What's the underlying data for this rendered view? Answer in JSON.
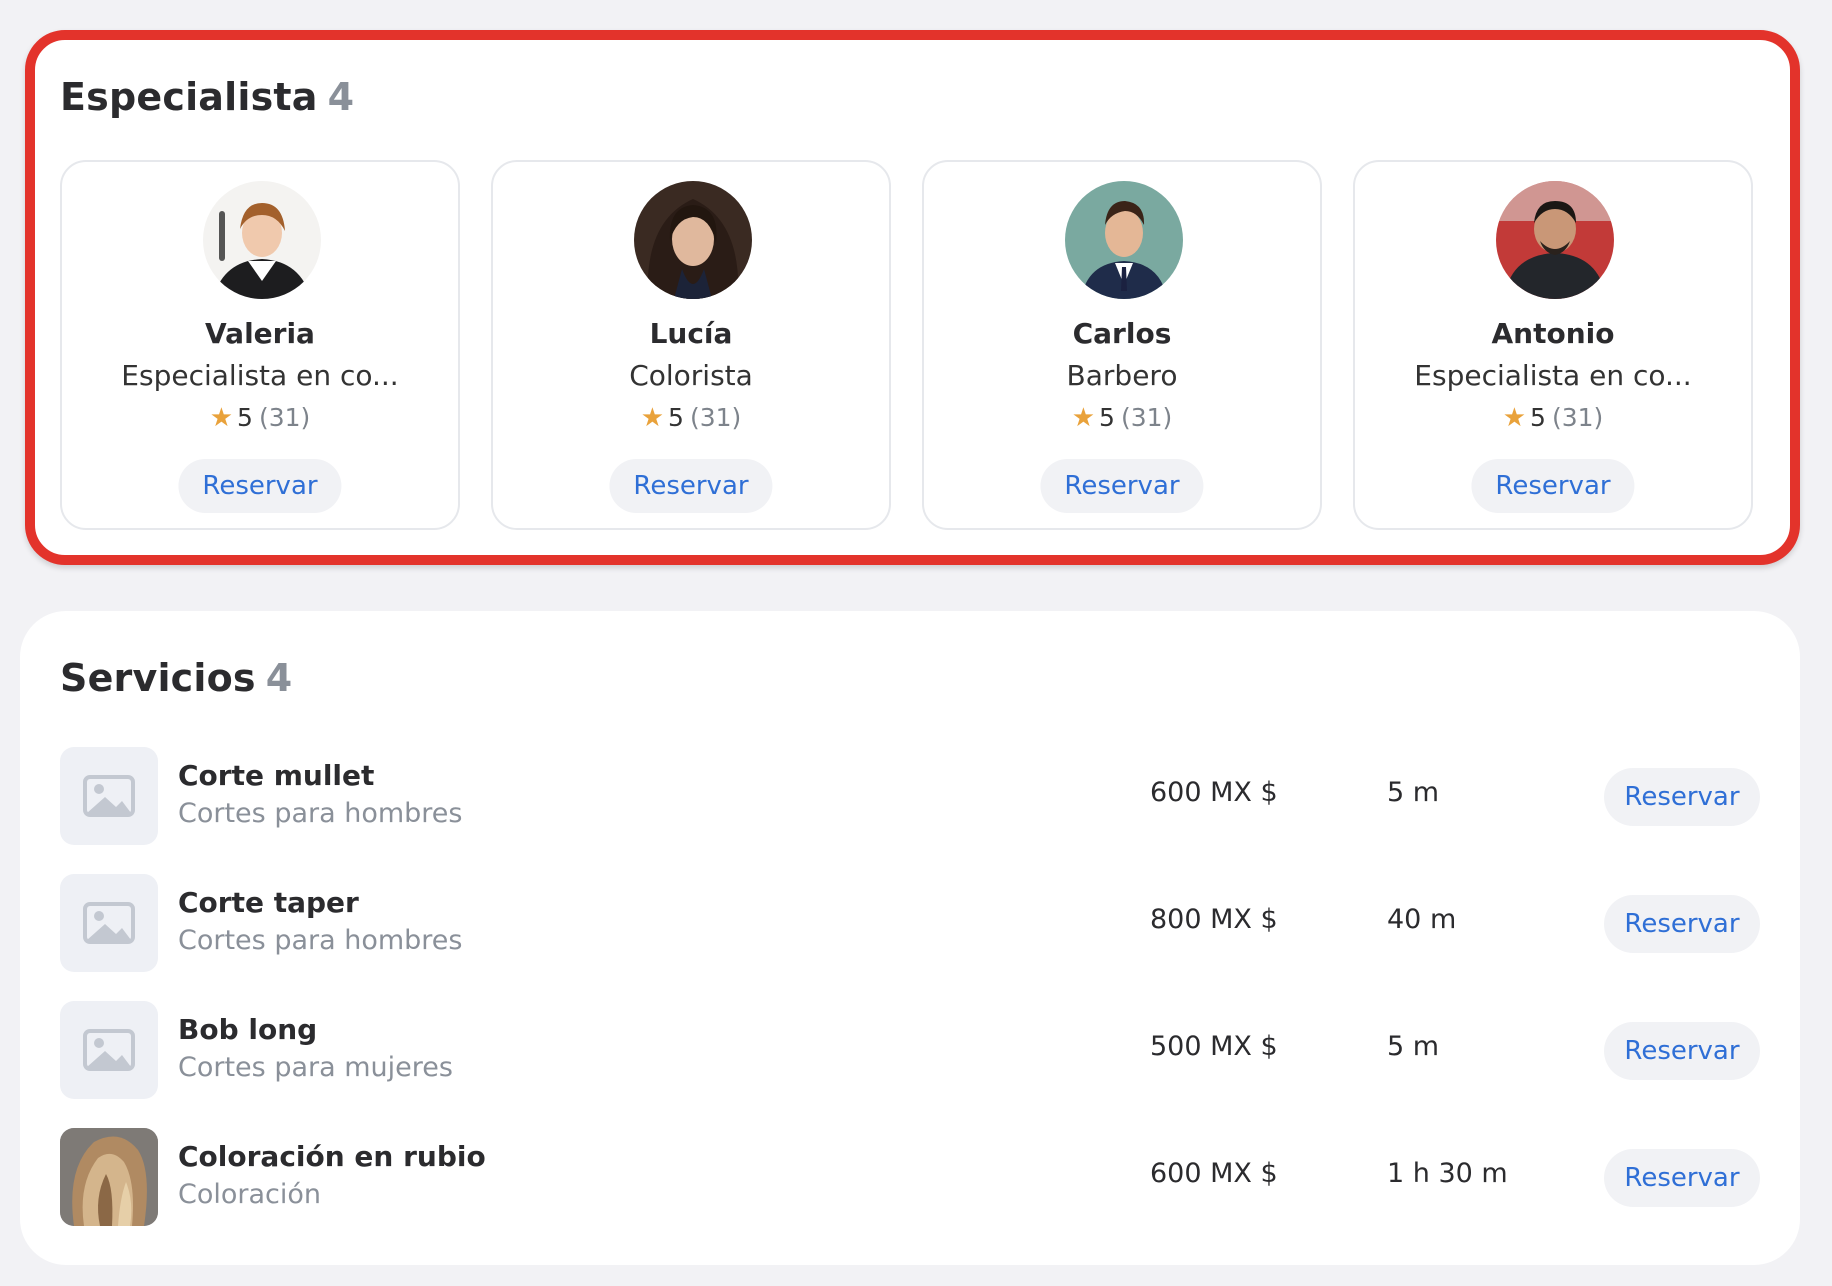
{
  "specialists": {
    "title": "Especialista",
    "count": "4",
    "items": [
      {
        "name": "Valeria",
        "role": "Especialista en co...",
        "rating": "5",
        "reviews": "(31)",
        "button": "Reservar",
        "avatar_icon": "person-photo"
      },
      {
        "name": "Lucía",
        "role": "Colorista",
        "rating": "5",
        "reviews": "(31)",
        "button": "Reservar",
        "avatar_icon": "person-photo"
      },
      {
        "name": "Carlos",
        "role": "Barbero",
        "rating": "5",
        "reviews": "(31)",
        "button": "Reservar",
        "avatar_icon": "person-photo"
      },
      {
        "name": "Antonio",
        "role": "Especialista en co...",
        "rating": "5",
        "reviews": "(31)",
        "button": "Reservar",
        "avatar_icon": "person-photo"
      }
    ]
  },
  "services": {
    "title": "Servicios",
    "count": "4",
    "items": [
      {
        "name": "Corte mullet",
        "category": "Cortes para hombres",
        "price": "600 MX $",
        "duration": "5 m",
        "button": "Reservar",
        "thumb_icon": "image-placeholder-icon"
      },
      {
        "name": "Corte taper",
        "category": "Cortes para hombres",
        "price": "800 MX $",
        "duration": "40 m",
        "button": "Reservar",
        "thumb_icon": "image-placeholder-icon"
      },
      {
        "name": "Bob long",
        "category": "Cortes para mujeres",
        "price": "500 MX $",
        "duration": "5 m",
        "button": "Reservar",
        "thumb_icon": "image-placeholder-icon"
      },
      {
        "name": "Coloración en rubio",
        "category": "Coloración",
        "price": "600 MX $",
        "duration": "1 h 30 m",
        "button": "Reservar",
        "thumb_icon": "hair-photo"
      }
    ]
  },
  "colors": {
    "highlight_border": "#e3332b",
    "accent_link": "#2f6fd6",
    "star": "#e9a23b",
    "muted_text": "#8a9099"
  }
}
